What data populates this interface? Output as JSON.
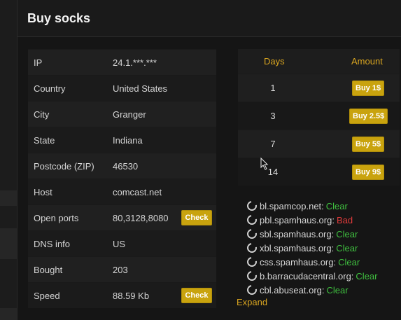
{
  "modal": {
    "title": "Buy socks"
  },
  "info": [
    {
      "label": "IP",
      "value": "24.1.***.***"
    },
    {
      "label": "Country",
      "value": "United States"
    },
    {
      "label": "City",
      "value": "Granger"
    },
    {
      "label": "State",
      "value": "Indiana"
    },
    {
      "label": "Postcode (ZIP)",
      "value": "46530"
    },
    {
      "label": "Host",
      "value": "comcast.net"
    },
    {
      "label": "Open ports",
      "value": "80,3128,8080",
      "button": "Check"
    },
    {
      "label": "DNS info",
      "value": "US"
    },
    {
      "label": "Bought",
      "value": "203"
    },
    {
      "label": "Speed",
      "value": "88.59 Kb",
      "button": "Check"
    }
  ],
  "pricing": {
    "headers": {
      "days": "Days",
      "amount": "Amount"
    },
    "rows": [
      {
        "days": "1",
        "button": "Buy 1$"
      },
      {
        "days": "3",
        "button": "Buy 2.5$"
      },
      {
        "days": "7",
        "button": "Buy 5$"
      },
      {
        "days": "14",
        "button": "Buy 9$"
      }
    ]
  },
  "blacklists": [
    {
      "host": "bl.spamcop.net:",
      "status": "Clear",
      "ok": true
    },
    {
      "host": "pbl.spamhaus.org:",
      "status": "Bad",
      "ok": false
    },
    {
      "host": "sbl.spamhaus.org:",
      "status": "Clear",
      "ok": true
    },
    {
      "host": "xbl.spamhaus.org:",
      "status": "Clear",
      "ok": true
    },
    {
      "host": "css.spamhaus.org:",
      "status": "Clear",
      "ok": true
    },
    {
      "host": "b.barracudacentral.org:",
      "status": "Clear",
      "ok": true
    },
    {
      "host": "cbl.abuseat.org:",
      "status": "Clear",
      "ok": true
    }
  ],
  "expand_label": "Expand",
  "colors": {
    "accent": "#c9a30e",
    "clear": "#3fbf3f",
    "bad": "#e03b3b"
  }
}
